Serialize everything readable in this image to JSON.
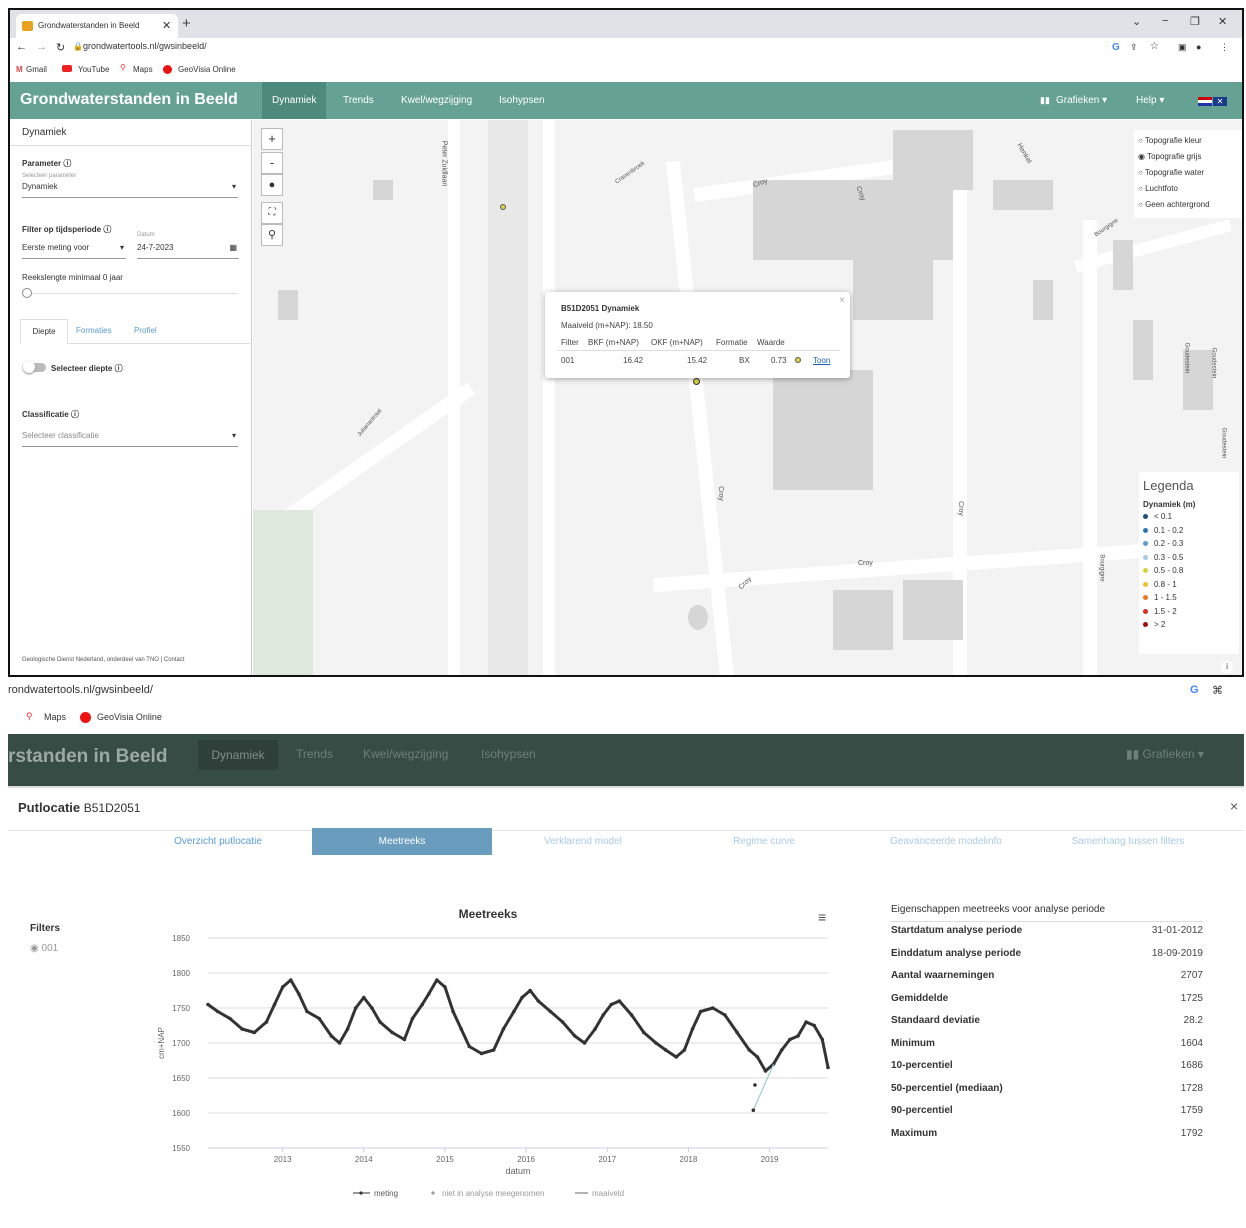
{
  "top": {
    "browser": {
      "tab_title": "Grondwaterstanden in Beeld",
      "url": "grondwatertools.nl/gwsinbeeld/",
      "bookmarks": [
        "Gmail",
        "YouTube",
        "Maps",
        "GeoVisia Online"
      ]
    },
    "app": {
      "title": "Grondwaterstanden in Beeld",
      "nav": [
        "Dynamiek",
        "Trends",
        "Kwel/wegzijging",
        "Isohypsen"
      ],
      "grafieken": "Grafieken",
      "help": "Help"
    },
    "sidebar": {
      "header": "Dynamiek",
      "parameter_label": "Parameter",
      "parameter_sub": "Selecteer parameter",
      "parameter_value": "Dynamiek",
      "filter_label": "Filter op tijdsperiode",
      "filter_option": "Eerste meting voor",
      "date_label": "Datum",
      "date_value": "24-7-2023",
      "reeks_label": "Reekslengte minimaal 0 jaar",
      "tabs": [
        "Diepte",
        "Formaties",
        "Profiel"
      ],
      "diepte_label": "Selecteer diepte",
      "classificatie_label": "Classificatie",
      "classificatie_placeholder": "Selecteer classificatie",
      "footer": "Geologische Dienst Nederland, onderdeel van TNO | Contact"
    },
    "map": {
      "streets": [
        "Peter Zuidlaan",
        "Cranenbroek",
        "Croy",
        "Croy",
        "Henkel",
        "Bourgigne",
        "Julianastraat",
        "Croy",
        "Croy",
        "Croy",
        "Croy",
        "Bourgigne",
        "Goudestein",
        "Goudestein",
        "Goudestein"
      ],
      "layers": [
        "Topografie kleur",
        "Topografie grijs",
        "Topografie water",
        "Luchtfoto",
        "Geen achtergrond"
      ],
      "selected_layer": 1,
      "popup": {
        "title": "B51D2051 Dynamiek",
        "maaiveld": "Maaiveld (m+NAP): 18.50",
        "headers": [
          "Filter",
          "BKF (m+NAP)",
          "OKF (m+NAP)",
          "Formatie",
          "Waarde"
        ],
        "row": [
          "001",
          "16.42",
          "15.42",
          "BX",
          "0.73"
        ],
        "link": "Toon"
      },
      "legend": {
        "title": "Legenda",
        "subtitle": "Dynamiek (m)",
        "items": [
          {
            "label": "< 0.1",
            "color": "#1f4e79"
          },
          {
            "label": "0.1 - 0.2",
            "color": "#2e75b6"
          },
          {
            "label": "0.2 - 0.3",
            "color": "#5b9bd5"
          },
          {
            "label": "0.3 - 0.5",
            "color": "#a5c8e4"
          },
          {
            "label": "0.5 - 0.8",
            "color": "#d8d440"
          },
          {
            "label": "0.8 - 1",
            "color": "#f0c030"
          },
          {
            "label": "1 - 1.5",
            "color": "#e87a20"
          },
          {
            "label": "1.5 - 2",
            "color": "#d83020"
          },
          {
            "label": "> 2",
            "color": "#a01010"
          }
        ]
      }
    }
  },
  "bottom": {
    "url": "rondwatertools.nl/gwsinbeeld/",
    "bookmarks": [
      "Maps",
      "GeoVisia Online"
    ],
    "app_title": "rstanden in Beeld",
    "nav": [
      "Dynamiek",
      "Trends",
      "Kwel/wegzijging",
      "Isohypsen"
    ],
    "grafieken": "Grafieken",
    "modal_title": "Putlocatie",
    "modal_id": "B51D2051",
    "tabs": [
      "Overzicht putlocatie",
      "Meetreeks",
      "Verklarend model",
      "Regime curve",
      "Geavanceerde modelinfo",
      "Samenhang tussen filters"
    ],
    "active_tab": 1,
    "filters_label": "Filters",
    "filter_item": "001",
    "props_title": "Eigenschappen meetreeks voor analyse periode",
    "props": [
      {
        "k": "Startdatum analyse periode",
        "v": "31-01-2012"
      },
      {
        "k": "Einddatum analyse periode",
        "v": "18-09-2019"
      },
      {
        "k": "Aantal waarnemingen",
        "v": "2707"
      },
      {
        "k": "Gemiddelde",
        "v": "1725"
      },
      {
        "k": "Standaard deviatie",
        "v": "28.2"
      },
      {
        "k": "Minimum",
        "v": "1604"
      },
      {
        "k": "10-percentiel",
        "v": "1686"
      },
      {
        "k": "50-percentiel (mediaan)",
        "v": "1728"
      },
      {
        "k": "90-percentiel",
        "v": "1759"
      },
      {
        "k": "Maximum",
        "v": "1792"
      }
    ]
  },
  "chart_data": {
    "type": "scatter",
    "title": "Meetreeks",
    "xlabel": "datum",
    "ylabel": "cm+NAP",
    "xlim": [
      2012.08,
      2019.72
    ],
    "ylim": [
      1550,
      1850
    ],
    "yticks": [
      1550,
      1600,
      1650,
      1700,
      1750,
      1800,
      1850
    ],
    "xticks": [
      "2013",
      "2014",
      "2015",
      "2016",
      "2017",
      "2018",
      "2019"
    ],
    "legend": [
      "meting",
      "niet in analyse meegenomen",
      "maaiveld"
    ],
    "series": [
      {
        "name": "meting",
        "color": "#333333",
        "x": [
          2012.08,
          2012.2,
          2012.35,
          2012.5,
          2012.65,
          2012.8,
          2012.9,
          2013.0,
          2013.1,
          2013.2,
          2013.3,
          2013.45,
          2013.6,
          2013.7,
          2013.8,
          2013.9,
          2014.0,
          2014.1,
          2014.2,
          2014.35,
          2014.5,
          2014.6,
          2014.72,
          2014.8,
          2014.9,
          2015.0,
          2015.1,
          2015.2,
          2015.3,
          2015.45,
          2015.6,
          2015.72,
          2015.85,
          2015.95,
          2016.05,
          2016.15,
          2016.3,
          2016.45,
          2016.6,
          2016.72,
          2016.85,
          2016.95,
          2017.05,
          2017.15,
          2017.3,
          2017.45,
          2017.6,
          2017.72,
          2017.85,
          2017.95,
          2018.05,
          2018.15,
          2018.3,
          2018.45,
          2018.6,
          2018.75,
          2018.85,
          2018.95,
          2019.05,
          2019.15,
          2019.25,
          2019.35,
          2019.45,
          2019.55,
          2019.65,
          2019.72
        ],
        "y": [
          1755,
          1745,
          1735,
          1720,
          1715,
          1730,
          1755,
          1780,
          1790,
          1770,
          1745,
          1735,
          1710,
          1700,
          1720,
          1750,
          1765,
          1750,
          1730,
          1715,
          1705,
          1735,
          1755,
          1770,
          1790,
          1780,
          1745,
          1720,
          1695,
          1685,
          1690,
          1720,
          1745,
          1765,
          1775,
          1760,
          1745,
          1730,
          1710,
          1700,
          1720,
          1740,
          1755,
          1760,
          1740,
          1715,
          1700,
          1690,
          1680,
          1690,
          1720,
          1745,
          1750,
          1740,
          1715,
          1690,
          1680,
          1660,
          1670,
          1690,
          1705,
          1710,
          1730,
          1725,
          1705,
          1665
        ]
      },
      {
        "name": "niet in analyse meegenomen",
        "color": "#999999",
        "x": [
          2018.8,
          2018.82
        ],
        "y": [
          1604,
          1640
        ]
      }
    ]
  }
}
